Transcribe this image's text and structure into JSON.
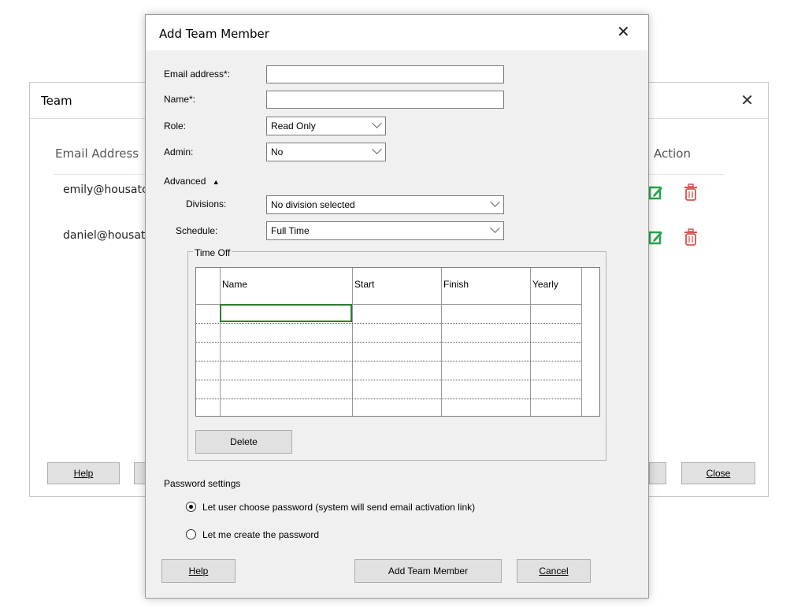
{
  "team_window": {
    "title": "Team",
    "close_glyph": "✕",
    "columns": {
      "email": "Email Address",
      "action": "Action"
    },
    "rows": [
      {
        "email": "emily@housatc"
      },
      {
        "email": "daniel@housat"
      }
    ],
    "help_label": "Help",
    "close_label": "Close"
  },
  "dialog": {
    "title": "Add Team Member",
    "close_glyph": "✕",
    "email_label": "Email address*:",
    "email_value": "",
    "name_label": "Name*:",
    "name_value": "",
    "role_label": "Role:",
    "role_value": "Read Only",
    "admin_label": "Admin:",
    "admin_value": "No",
    "advanced_label": "Advanced",
    "advanced_glyph": "▲",
    "divisions_label": "Divisions:",
    "divisions_value": "No division selected",
    "schedule_label": "Schedule:",
    "schedule_value": "Full Time",
    "time_off": {
      "group_label": "Time Off",
      "columns": [
        "Name",
        "Start",
        "Finish",
        "Yearly"
      ],
      "delete_label": "Delete"
    },
    "password": {
      "heading": "Password settings",
      "option1": "Let user choose password (system will send email activation link)",
      "option2": "Let me create the password",
      "selected": "option1"
    },
    "buttons": {
      "help": "Help",
      "add": "Add Team Member",
      "cancel": "Cancel"
    }
  },
  "colors": {
    "edit_icon": "#22a84a",
    "delete_icon": "#d9534f",
    "cell_focus": "#2e7d32"
  }
}
